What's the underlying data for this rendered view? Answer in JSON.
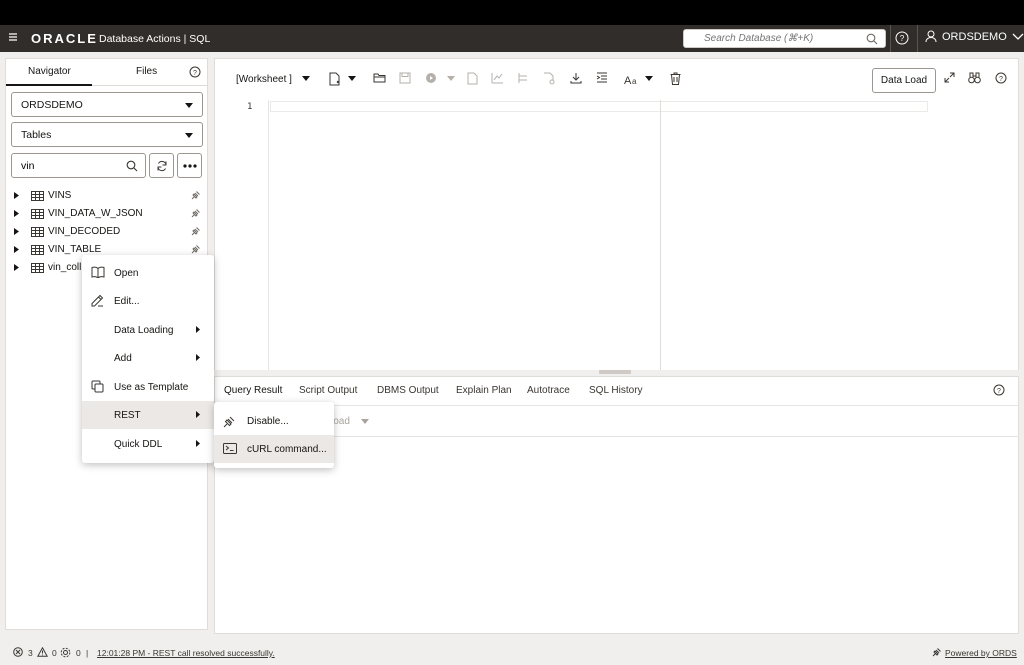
{
  "header": {
    "logo": "ORACLE",
    "app_title": "Database Actions | SQL",
    "search_placeholder": "Search Database (⌘+K)",
    "user": "ORDSDEMO"
  },
  "navigator": {
    "tabs": {
      "navigator": "Navigator",
      "files": "Files"
    },
    "schema": "ORDSDEMO",
    "object_type": "Tables",
    "filter_value": "vin",
    "items": [
      {
        "label": "VINS"
      },
      {
        "label": "VIN_DATA_W_JSON"
      },
      {
        "label": "VIN_DECODED"
      },
      {
        "label": "VIN_TABLE"
      },
      {
        "label": "vin_coll"
      }
    ]
  },
  "editor": {
    "worksheet_label": "[Worksheet ]",
    "data_load_label": "Data Load",
    "line_number": "1"
  },
  "results": {
    "tabs": [
      {
        "label": "Query Result"
      },
      {
        "label": "Script Output"
      },
      {
        "label": "DBMS Output"
      },
      {
        "label": "Explain Plan"
      },
      {
        "label": "Autotrace"
      },
      {
        "label": "SQL History"
      }
    ],
    "download_label": "load"
  },
  "context_menu": {
    "items": [
      {
        "label": "Open",
        "icon": "book-open-icon"
      },
      {
        "label": "Edit...",
        "icon": "pencil-icon"
      },
      {
        "label": "Data Loading",
        "submenu": true
      },
      {
        "label": "Add",
        "submenu": true
      },
      {
        "label": "Use as Template",
        "icon": "copy-icon"
      },
      {
        "label": "REST",
        "submenu": true,
        "active": true
      },
      {
        "label": "Quick DDL",
        "submenu": true
      }
    ],
    "rest_submenu": [
      {
        "label": "Disable...",
        "icon": "plug-disconnected-icon"
      },
      {
        "label": "cURL command...",
        "icon": "terminal-icon",
        "active": true
      }
    ]
  },
  "status": {
    "errors": "3",
    "warnings": "0",
    "processes": "0",
    "message": "12:01:28 PM - REST call resolved successfully.",
    "powered_by": "Powered by ORDS"
  }
}
